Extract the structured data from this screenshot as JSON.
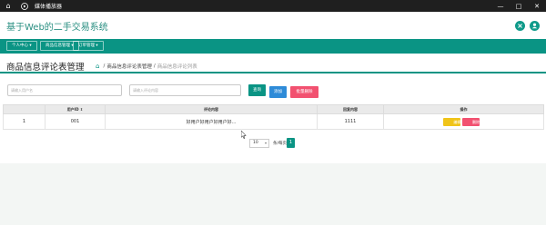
{
  "titlebar": {
    "home_icon": "home-icon",
    "play_icon": "play-icon",
    "app_name": "媒体播放器",
    "minimize": "—",
    "maximize": "□",
    "close": "✕"
  },
  "header": {
    "site_title": "基于Web的二手交易系统",
    "icons": [
      "expand-icon",
      "user-icon"
    ],
    "accent_color": "#0a9484"
  },
  "nav": {
    "items": [
      {
        "label": "个人中心 ▾"
      },
      {
        "label": "商品信息管理 ▾"
      },
      {
        "label": "订单管理 ▾"
      }
    ]
  },
  "page": {
    "title": "商品信息评论表管理",
    "breadcrumb": {
      "home_icon": "home-icon",
      "sep1": "/",
      "parent": "商品信息评论表管理",
      "sep2": "/",
      "current": "商品信息评论列表"
    }
  },
  "search": {
    "username_placeholder": "请输入用户名",
    "content_placeholder": "请输入评论内容",
    "query_label": "查询",
    "add_label": "添加",
    "batch_delete_label": "批量删除",
    "colors": {
      "query": "#0a9484",
      "add": "#2e8bd8",
      "delete": "#f25170"
    }
  },
  "table": {
    "headers": [
      "",
      "用户ID ⇕",
      "评论内容",
      "回复内容",
      "操作"
    ],
    "rows": [
      {
        "index": "1",
        "user_id": "001",
        "content": "好用户好用户好用户好...",
        "reply": "1111",
        "edit": "编辑",
        "delete": "删除"
      }
    ],
    "colors": {
      "edit": "#f0c419",
      "delete": "#f25170"
    }
  },
  "pagination": {
    "page_size": "10",
    "per_page_label": "条/每页",
    "current_page": "1"
  }
}
